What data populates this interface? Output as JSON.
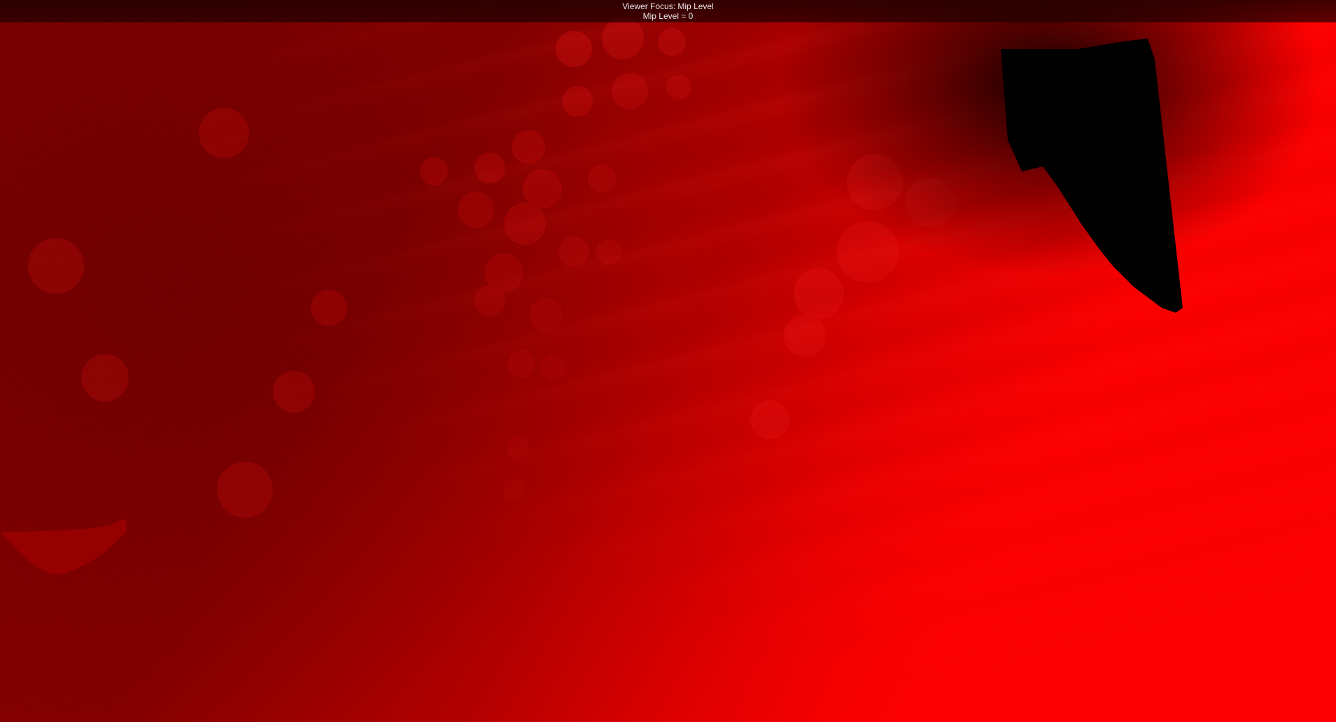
{
  "status": {
    "focus_label": "Viewer Focus: Mip Level",
    "mip_level_label": "Mip Level = 0"
  },
  "colors": {
    "dark_red": "#7a0000",
    "bright_red": "#ff0000",
    "shadow": "#000000"
  }
}
